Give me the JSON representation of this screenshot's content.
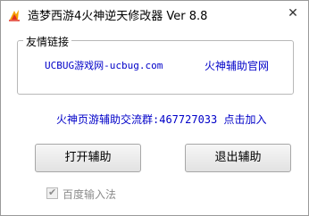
{
  "window": {
    "title": "造梦西游4火神逆天修改器  Ver 8.8",
    "close_symbol": "✕",
    "app_icon": "fire-icon"
  },
  "links_group": {
    "label": "友情链接",
    "link_ucbug": "UCBUG游戏网-ucbug.com",
    "link_official": "火神辅助官网"
  },
  "qq_group_text": "火神页游辅助交流群:467727033 点击加入",
  "buttons": {
    "open_label": "打开辅助",
    "exit_label": "退出辅助"
  },
  "ime_checkbox": {
    "label": "百度输入法",
    "checked": true,
    "enabled": false
  },
  "colors": {
    "link": "#0000c8",
    "disabled_text": "#8c8c8c",
    "icon_red": "#e0301e",
    "icon_orange": "#f5a000"
  }
}
